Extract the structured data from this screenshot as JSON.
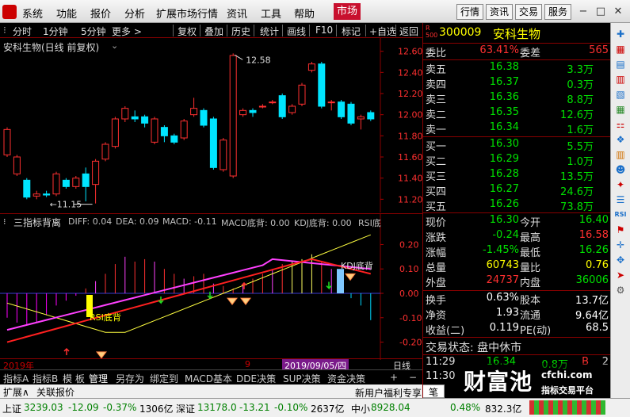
{
  "menubar": {
    "items": [
      "系统",
      "功能",
      "报价",
      "分析",
      "扩展市场行情",
      "资讯",
      "工具",
      "帮助"
    ],
    "active": "市场",
    "right_buttons": [
      "行情",
      "资讯",
      "交易",
      "服务"
    ],
    "window_controls": [
      "−",
      "□",
      "✕"
    ]
  },
  "toolbar": {
    "periods": [
      "分时",
      "1分钟",
      "5分钟",
      "更多 >"
    ],
    "tools": [
      "复权",
      "叠加",
      "历史",
      "统计",
      "画线",
      "F10",
      "标记",
      "+自选",
      "返回"
    ]
  },
  "kchart": {
    "title": "安科生物(日线 前复权)",
    "price_axis": [
      "12.60",
      "12.40",
      "12.20",
      "12.00",
      "11.80",
      "11.60",
      "11.40",
      "11.20"
    ],
    "high_label": "12.58",
    "low_label": "11.15",
    "candles": [
      {
        "o": 11.62,
        "c": 11.86,
        "h": 11.88,
        "l": 11.6
      },
      {
        "o": 11.44,
        "c": 11.6,
        "h": 11.62,
        "l": 11.42
      },
      {
        "o": 11.38,
        "c": 11.22,
        "h": 11.4,
        "l": 11.2
      },
      {
        "o": 11.23,
        "c": 11.25,
        "h": 11.28,
        "l": 11.2
      },
      {
        "o": 11.25,
        "c": 11.24,
        "h": 11.28,
        "l": 11.22
      },
      {
        "o": 11.25,
        "c": 11.44,
        "h": 11.46,
        "l": 11.23
      },
      {
        "o": 11.38,
        "c": 11.32,
        "h": 11.4,
        "l": 11.3
      },
      {
        "o": 11.32,
        "c": 11.4,
        "h": 11.42,
        "l": 11.3
      },
      {
        "o": 11.44,
        "c": 11.32,
        "h": 11.5,
        "l": 11.18
      },
      {
        "o": 11.34,
        "c": 11.56,
        "h": 11.58,
        "l": 11.16
      },
      {
        "o": 11.58,
        "c": 11.72,
        "h": 11.74,
        "l": 11.56
      },
      {
        "o": 11.7,
        "c": 11.96,
        "h": 11.98,
        "l": 11.68
      },
      {
        "o": 11.96,
        "c": 12.06,
        "h": 12.08,
        "l": 11.93
      },
      {
        "o": 11.98,
        "c": 11.96,
        "h": 12.04,
        "l": 11.93
      },
      {
        "o": 11.98,
        "c": 11.92,
        "h": 12.0,
        "l": 11.88
      },
      {
        "o": 11.74,
        "c": 11.96,
        "h": 11.98,
        "l": 11.72
      },
      {
        "o": 11.88,
        "c": 11.8,
        "h": 11.9,
        "l": 11.74
      },
      {
        "o": 11.8,
        "c": 11.74,
        "h": 11.82,
        "l": 11.72
      },
      {
        "o": 11.78,
        "c": 11.94,
        "h": 11.96,
        "l": 11.76
      },
      {
        "o": 12.0,
        "c": 12.06,
        "h": 12.16,
        "l": 11.98
      },
      {
        "o": 12.04,
        "c": 11.9,
        "h": 12.06,
        "l": 11.88
      },
      {
        "o": 11.96,
        "c": 11.5,
        "h": 11.98,
        "l": 11.48
      },
      {
        "o": 11.48,
        "c": 11.76,
        "h": 11.78,
        "l": 11.46
      },
      {
        "o": 11.42,
        "c": 12.56,
        "h": 12.58,
        "l": 11.4
      },
      {
        "o": 12.0,
        "c": 12.04,
        "h": 12.06,
        "l": 11.98
      },
      {
        "o": 12.04,
        "c": 12.02,
        "h": 12.06,
        "l": 11.98
      },
      {
        "o": 12.08,
        "c": 12.08,
        "h": 12.1,
        "l": 12.06
      },
      {
        "o": 12.12,
        "c": 12.12,
        "h": 12.14,
        "l": 12.1
      },
      {
        "o": 12.18,
        "c": 11.98,
        "h": 12.2,
        "l": 11.96
      },
      {
        "o": 12.02,
        "c": 12.08,
        "h": 12.1,
        "l": 12.0
      },
      {
        "o": 12.1,
        "c": 12.28,
        "h": 12.3,
        "l": 12.08
      },
      {
        "o": 12.42,
        "c": 12.48,
        "h": 12.5,
        "l": 12.4
      },
      {
        "o": 12.48,
        "c": 12.08,
        "h": 12.5,
        "l": 12.06
      },
      {
        "o": 12.12,
        "c": 12.12,
        "h": 12.14,
        "l": 12.04
      },
      {
        "o": 12.12,
        "c": 11.98,
        "h": 12.14,
        "l": 11.96
      },
      {
        "o": 12.1,
        "c": 11.92,
        "h": 12.12,
        "l": 11.9
      },
      {
        "o": 11.96,
        "c": 11.98,
        "h": 12.0,
        "l": 11.86
      },
      {
        "o": 12.02,
        "c": 11.96,
        "h": 12.04,
        "l": 11.94
      }
    ]
  },
  "indicator": {
    "name": "三指标背离",
    "legend": [
      {
        "text": "DIFF: 0.04",
        "color": "#ffffff"
      },
      {
        "text": "DEA: 0.09",
        "color": "#ffff00"
      },
      {
        "text": "MACD: -0.11",
        "color": "#ff00ff"
      },
      {
        "text": "MACD底背: 0.00",
        "color": "#ff3030"
      },
      {
        "text": "KDJ底背: 0.00",
        "color": "#ff00ff"
      },
      {
        "text": "RSI底",
        "color": "#ffff00"
      }
    ],
    "axis": [
      "0.20",
      "0.10",
      "0.00",
      "-0.10",
      "-0.20"
    ],
    "rsi_label": "RSI底背",
    "kdj_label": "KDJ底背",
    "macd": [
      -0.1,
      -0.12,
      -0.13,
      -0.12,
      -0.09,
      -0.05,
      -0.03,
      -0.01,
      0.02,
      0.05,
      0.08,
      0.12,
      0.15,
      0.13,
      0.14,
      0.13,
      0.1,
      0.08,
      0.06,
      0.07,
      0.08,
      0.04,
      0.03,
      0.02,
      0.03,
      0.06,
      0.08,
      0.1,
      0.12,
      0.13,
      0.14,
      0.16,
      0.13,
      0.1,
      0.06,
      -0.02,
      -0.05,
      -0.11
    ]
  },
  "datebar": {
    "labels": [
      "2019年",
      "9",
      "2019/09/05/四"
    ],
    "right": "日线"
  },
  "bottom_tabs": {
    "row1": [
      "指标A",
      "指标B",
      "模 板",
      "管理",
      "另存为",
      "绑定到",
      "MACD基本",
      "DDE决策",
      "SUP决策",
      "资金决策",
      "+",
      "−"
    ],
    "row2": [
      "扩展∧",
      "关联报价"
    ],
    "row2_right": [
      "新用户福利专享",
      "笔",
      "价"
    ]
  },
  "quote": {
    "code": "300009",
    "name": "安科生物",
    "badge_top": "R",
    "badge_bottom": "500",
    "weibi_label": "委比",
    "weibi": "63.41%",
    "weicha_label": "委差",
    "weicha": "565",
    "asks": [
      {
        "label": "卖五",
        "price": "16.38",
        "vol": "3.3万"
      },
      {
        "label": "卖四",
        "price": "16.37",
        "vol": "0.3万"
      },
      {
        "label": "卖三",
        "price": "16.36",
        "vol": "8.8万"
      },
      {
        "label": "卖二",
        "price": "16.35",
        "vol": "12.6万"
      },
      {
        "label": "卖一",
        "price": "16.34",
        "vol": "1.6万"
      }
    ],
    "bids": [
      {
        "label": "买一",
        "price": "16.30",
        "vol": "5.5万"
      },
      {
        "label": "买二",
        "price": "16.29",
        "vol": "1.0万"
      },
      {
        "label": "买三",
        "price": "16.28",
        "vol": "13.5万"
      },
      {
        "label": "买四",
        "price": "16.27",
        "vol": "24.6万"
      },
      {
        "label": "买五",
        "price": "16.26",
        "vol": "73.8万"
      }
    ],
    "stats": [
      {
        "l1": "现价",
        "v1": "16.30",
        "c1": "green",
        "l2": "今开",
        "v2": "16.40",
        "c2": "green"
      },
      {
        "l1": "涨跌",
        "v1": "-0.24",
        "c1": "green",
        "l2": "最高",
        "v2": "16.58",
        "c2": "red"
      },
      {
        "l1": "涨幅",
        "v1": "-1.45%",
        "c1": "green",
        "l2": "最低",
        "v2": "16.26",
        "c2": "green"
      },
      {
        "l1": "总量",
        "v1": "60743",
        "c1": "yel",
        "l2": "量比",
        "v2": "0.76",
        "c2": "yel"
      },
      {
        "l1": "外盘",
        "v1": "24737",
        "c1": "red",
        "l2": "内盘",
        "v2": "36006",
        "c2": "green"
      }
    ],
    "stats2": [
      {
        "l1": "换手",
        "v1": "0.63%",
        "l2": "股本",
        "v2": "13.7亿"
      },
      {
        "l1": "净资",
        "v1": "1.93",
        "l2": "流通",
        "v2": "9.64亿"
      },
      {
        "l1": "收益(二)",
        "v1": "0.119",
        "l2": "PE(动)",
        "v2": "68.5"
      }
    ],
    "trade_status": "交易状态: 盘中休市",
    "ticks": [
      {
        "time": "11:29",
        "price": "16.34",
        "vol": "0.8万",
        "flag": "B",
        "n": "2"
      },
      {
        "time": "11:30",
        "price": "",
        "vol": "",
        "flag": "",
        "n": ""
      }
    ]
  },
  "watermark": {
    "logo": "财富池",
    "site": "cfchi.com",
    "sub": "指标交易平台"
  },
  "status": [
    {
      "name": "上证",
      "val": "3239.03",
      "chg": "-12.09",
      "pct": "-0.37%",
      "amt": "1306亿"
    },
    {
      "name": "深证",
      "val": "13178.0",
      "chg": "-13.21",
      "pct": "-0.10%",
      "amt": "2637亿"
    },
    {
      "name": "中小",
      "val": "8928.04",
      "chg": "",
      "pct": "0.48%",
      "amt": "832.3亿"
    }
  ],
  "colors": {
    "up": "#ff3030",
    "down": "#00e5ff",
    "panel_border": "#800000"
  }
}
